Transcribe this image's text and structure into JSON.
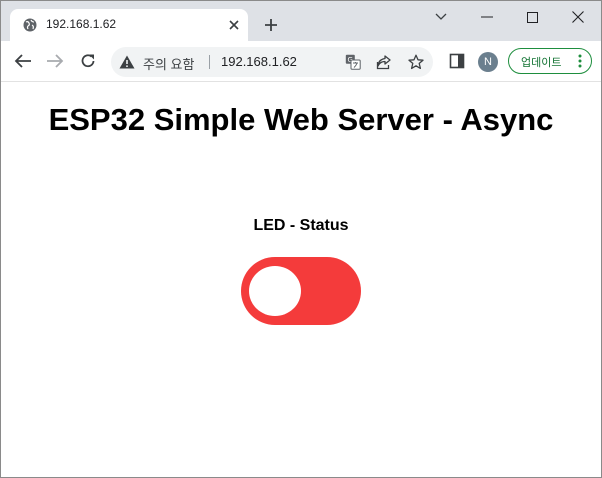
{
  "browser": {
    "tab_title": "192.168.1.62",
    "omnibox": {
      "security_label": "주의 요함",
      "url": "192.168.1.62"
    },
    "profile_initial": "N",
    "update_label": "업데이트"
  },
  "page": {
    "title": "ESP32 Simple Web Server - Async",
    "status_label": "LED - Status",
    "led_state": "off",
    "switch_color": "#f43b3b"
  },
  "icons": [
    "globe-icon",
    "close-icon",
    "plus-icon",
    "chevron-down-icon",
    "minimize-icon",
    "maximize-icon",
    "close-window-icon",
    "back-arrow-icon",
    "forward-arrow-icon",
    "reload-icon",
    "warning-icon",
    "translate-icon",
    "share-icon",
    "star-icon",
    "side-panel-icon",
    "more-vert-icon"
  ]
}
